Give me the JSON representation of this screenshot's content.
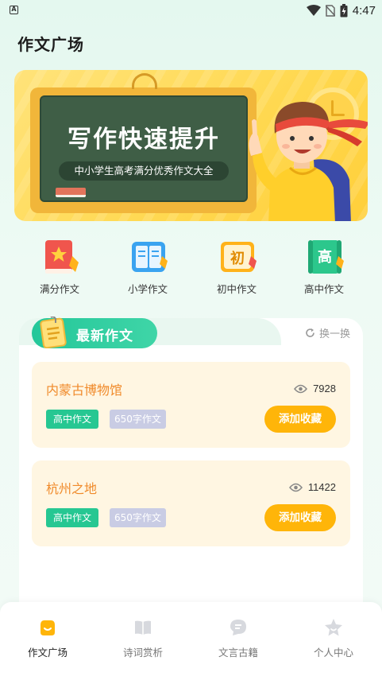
{
  "status_bar": {
    "time": "4:47",
    "notification_icon": "a-icon",
    "icons": [
      "wifi-icon",
      "no-sim-icon",
      "battery-charging-icon"
    ]
  },
  "header": {
    "title": "作文广场"
  },
  "banner": {
    "title": "写作快速提升",
    "subtitle": "中小学生高考满分优秀作文大全"
  },
  "categories": [
    {
      "label": "满分作文",
      "icon": "red-book-star-icon",
      "color": "#f0554d"
    },
    {
      "label": "小学作文",
      "icon": "blue-open-book-icon",
      "color": "#3aa3f0"
    },
    {
      "label": "初中作文",
      "icon": "yellow-chu-icon",
      "glyph": "初",
      "color": "#ffb21a"
    },
    {
      "label": "高中作文",
      "icon": "green-gao-icon",
      "glyph": "高",
      "color": "#2cc78c"
    }
  ],
  "section": {
    "title": "最新作文",
    "refresh_label": "换一换"
  },
  "essays": [
    {
      "title": "内蒙古博物馆",
      "views": "7928",
      "level": "高中作文",
      "words": "650字作文",
      "fav_label": "添加收藏"
    },
    {
      "title": "杭州之地",
      "views": "11422",
      "level": "高中作文",
      "words": "650字作文",
      "fav_label": "添加收藏"
    }
  ],
  "bottom_nav": [
    {
      "label": "作文广场",
      "icon": "home-essay-icon",
      "active": true
    },
    {
      "label": "诗词赏析",
      "icon": "book-icon",
      "active": false
    },
    {
      "label": "文言古籍",
      "icon": "chat-bubble-icon",
      "active": false
    },
    {
      "label": "个人中心",
      "icon": "star-user-icon",
      "active": false
    }
  ],
  "colors": {
    "accent_green": "#26c792",
    "accent_orange": "#ffb509",
    "title_orange": "#f08a2a",
    "banner_yellow": "#ffd84f"
  }
}
